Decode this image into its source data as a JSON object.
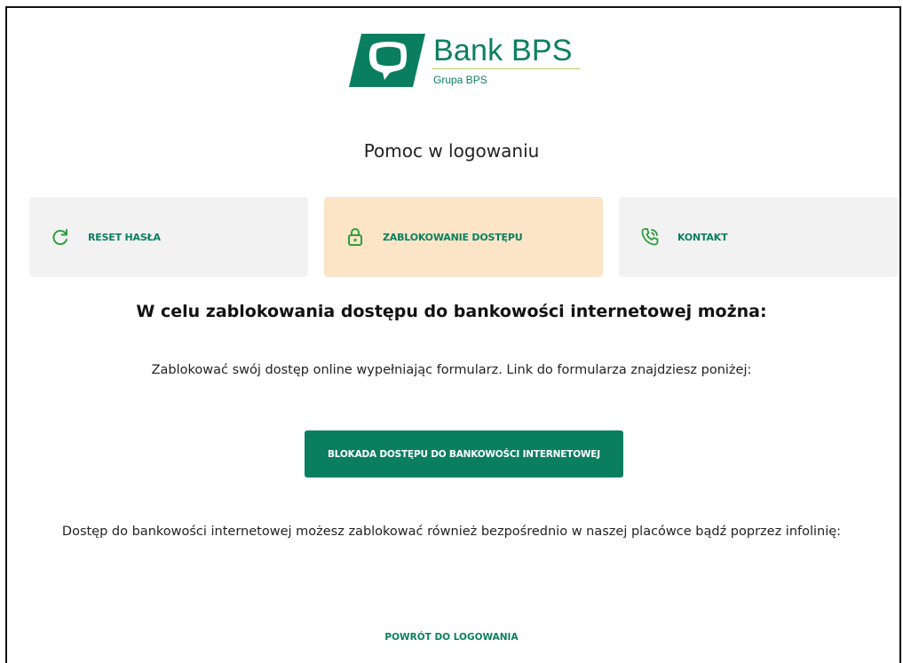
{
  "brand": {
    "name": "Bank BPS",
    "sub": "Grupa BPS",
    "color": "#0a7f5f"
  },
  "page_title": "Pomoc w logowaniu",
  "tiles": [
    {
      "label": "RESET HASŁA",
      "icon": "refresh-icon",
      "active": false
    },
    {
      "label": "ZABLOKOWANIE DOSTĘPU",
      "icon": "lock-icon",
      "active": true
    },
    {
      "label": "KONTAKT",
      "icon": "phone-icon",
      "active": false
    }
  ],
  "heading": "W celu zablokowania dostępu do bankowości internetowej można:",
  "paragraph1": "Zablokować swój dostęp online wypełniając formularz. Link do formularza znajdziesz poniżej:",
  "block_button": "BLOKADA DOSTĘPU DO BANKOWOŚCI INTERNETOWEJ",
  "paragraph2": "Dostęp do bankowości internetowej możesz zablokować również bezpośrednio w naszej placówce bądź poprzez infolinię:",
  "back_link": "POWRÓT DO LOGOWANIA",
  "colors": {
    "accent": "#0a7f5f",
    "active_tile": "#fce5c7",
    "tile": "#f2f2f2"
  }
}
